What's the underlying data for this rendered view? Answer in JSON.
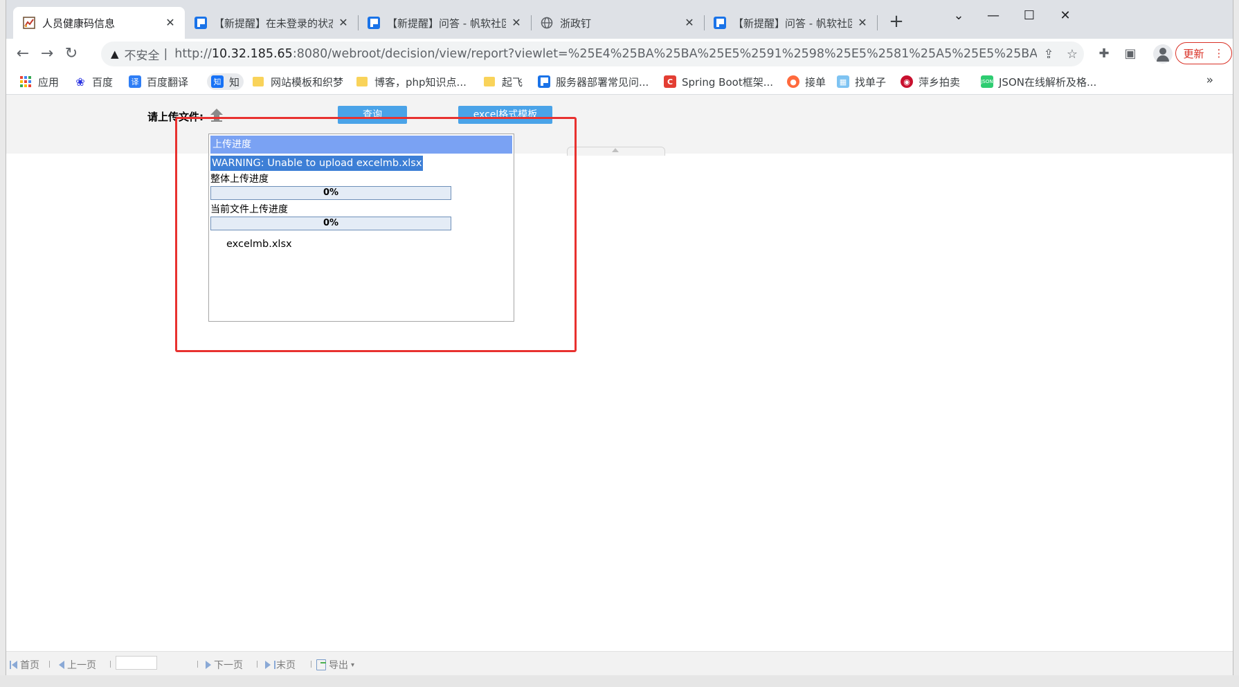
{
  "browser": {
    "tabs": [
      {
        "title": "人员健康码信息",
        "icon": "report-favicon",
        "active": true
      },
      {
        "title": "【新提醒】在未登录的状态下上",
        "icon": "fanruan-favicon",
        "active": false
      },
      {
        "title": "【新提醒】问答 - 帆软社区",
        "icon": "fanruan-favicon",
        "active": false
      },
      {
        "title": "浙政钉",
        "icon": "globe-favicon",
        "active": false
      },
      {
        "title": "【新提醒】问答 - 帆软社区",
        "icon": "fanruan-favicon",
        "active": false
      }
    ],
    "address": {
      "security_label": "不安全",
      "url_host": "10.32.185.65",
      "url_scheme": "http://",
      "url_rest": ":8080/webroot/decision/view/report?viewlet=%25E4%25BA%25BA%25E5%2591%2598%25E5%2581%25A5%25E5%25BA%..."
    },
    "update_label": "更新",
    "bookmarks": [
      {
        "label": "应用",
        "icon": "apps-grid-icon"
      },
      {
        "label": "百度",
        "icon": "baidu-paw-icon"
      },
      {
        "label": "百度翻译",
        "icon": "baidu-translate-icon"
      },
      {
        "label": "知",
        "icon": "zhihu-icon"
      },
      {
        "label": "网站模板和织梦",
        "icon": "folder-icon"
      },
      {
        "label": "博客，php知识点...",
        "icon": "folder-icon"
      },
      {
        "label": "起飞",
        "icon": "folder-icon"
      },
      {
        "label": "服务器部署常见问...",
        "icon": "fanruan-favicon"
      },
      {
        "label": "Spring Boot框架...",
        "icon": "csdn-icon"
      },
      {
        "label": "接单",
        "icon": "orange-circle-icon"
      },
      {
        "label": "找单子",
        "icon": "grid-tile-icon"
      },
      {
        "label": "萍乡拍卖",
        "icon": "red-seal-icon"
      },
      {
        "label": "JSON在线解析及格...",
        "icon": "json-icon"
      }
    ],
    "bookmarks_more": "»",
    "colors": {
      "tabstrip": "#dee1e6",
      "accent_red": "#d93025"
    }
  },
  "report": {
    "upload_label": "请上传文件:",
    "query_button": "查询",
    "excel_template_button": "excel格式模板",
    "upload_dialog": {
      "title": "上传进度",
      "warning": "WARNING: Unable to upload excelmb.xlsx",
      "overall_label": "整体上传进度",
      "overall_progress": "0%",
      "overall_fraction": 0,
      "current_label": "当前文件上传进度",
      "current_progress": "0%",
      "current_fraction": 0,
      "file_name": "excelmb.xlsx"
    },
    "colors": {
      "button": "#4aa3e8",
      "dialog_title": "#7aa2f3",
      "annotation_box": "#e8312f"
    }
  },
  "pager": {
    "first": "首页",
    "prev": "上一页",
    "page_input_value": "",
    "next": "下一页",
    "last": "末页",
    "export": "导出"
  }
}
